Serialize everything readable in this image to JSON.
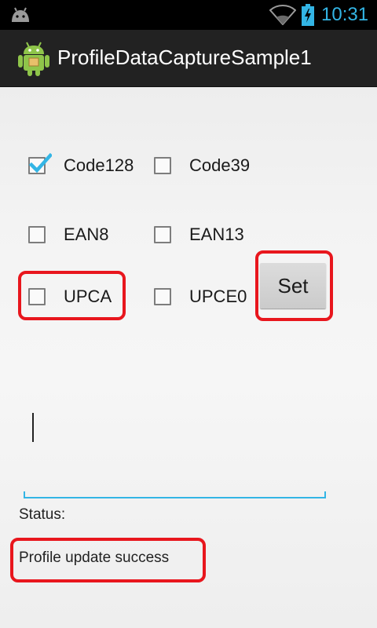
{
  "status_bar": {
    "time": "10:31",
    "icons": [
      "android-debug-icon",
      "wifi-icon",
      "battery-charging-icon"
    ],
    "time_color": "#33b5e5"
  },
  "action_bar": {
    "title": "ProfileDataCaptureSample1",
    "icon": "android-app-icon"
  },
  "barcodes": [
    {
      "label": "Code128",
      "checked": true
    },
    {
      "label": "Code39",
      "checked": false
    },
    {
      "label": "EAN8",
      "checked": false
    },
    {
      "label": "EAN13",
      "checked": false
    },
    {
      "label": "UPCA",
      "checked": false
    },
    {
      "label": "UPCE0",
      "checked": false
    }
  ],
  "set_button": {
    "label": "Set"
  },
  "input": {
    "value": ""
  },
  "status": {
    "label": "Status:",
    "message": "Profile update success"
  },
  "colors": {
    "accent": "#33b5e5",
    "highlight": "#e8161d",
    "action_bar": "#222222"
  }
}
